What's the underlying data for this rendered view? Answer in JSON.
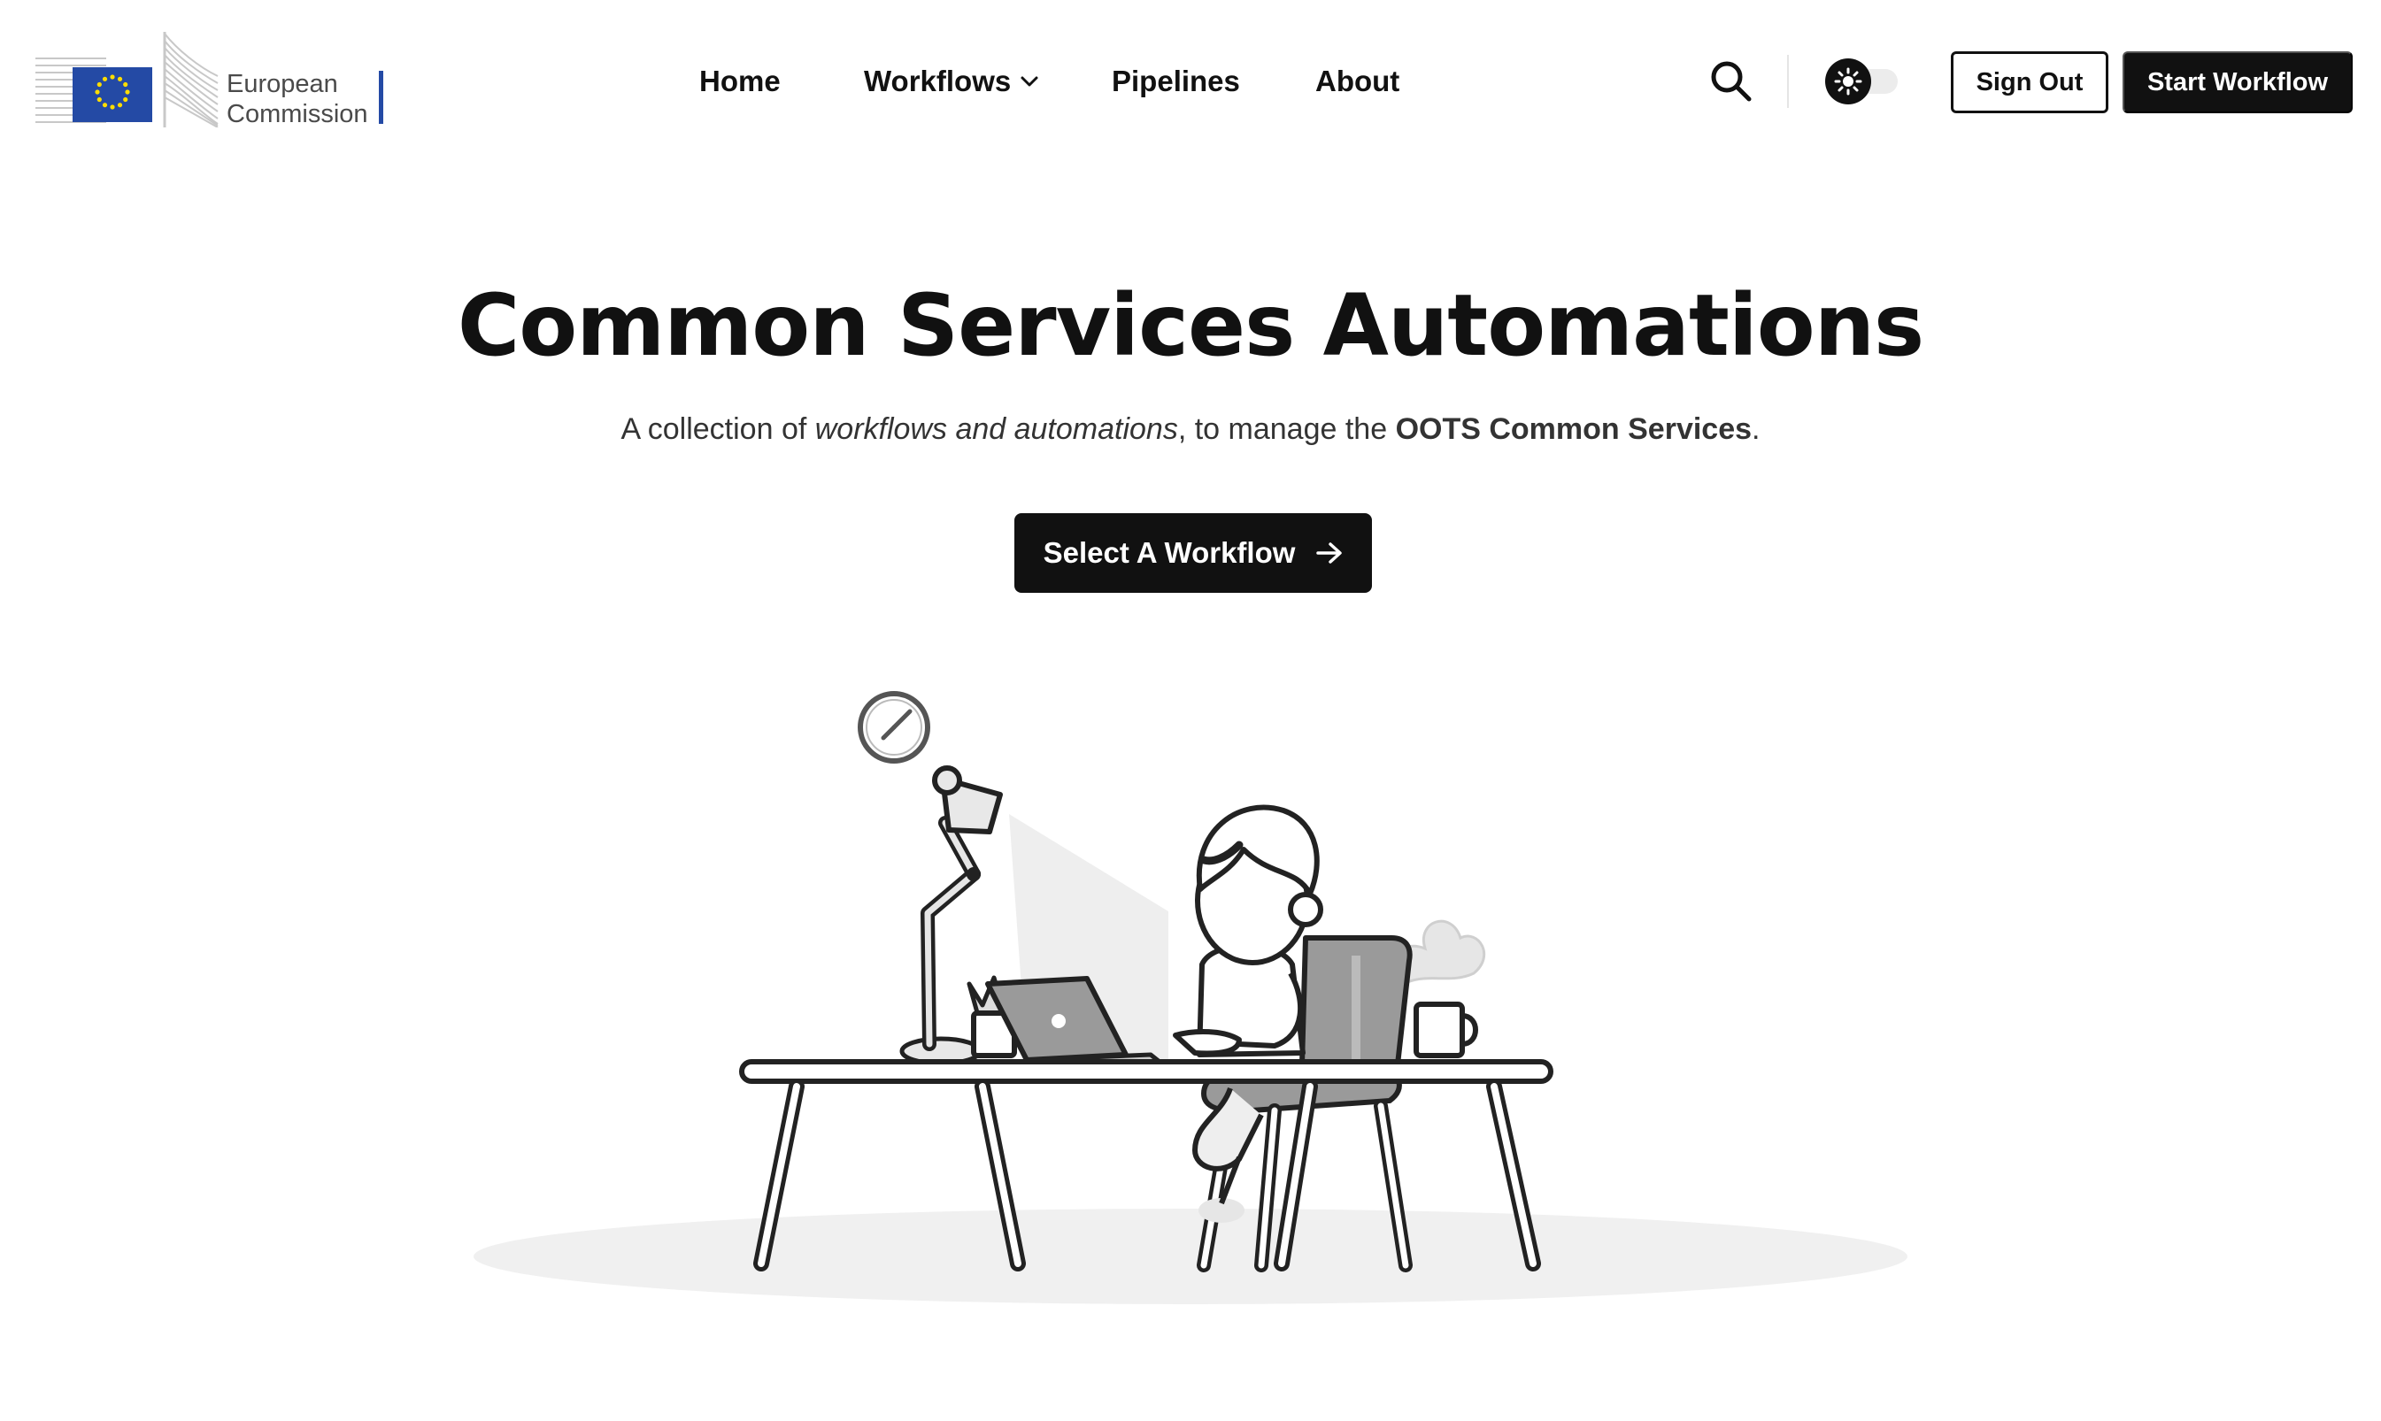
{
  "header": {
    "logo": {
      "line1": "European",
      "line2": "Commission",
      "alt": "European Commission"
    },
    "nav": {
      "home": "Home",
      "workflows": "Workflows",
      "pipelines": "Pipelines",
      "about": "About"
    },
    "icons": {
      "search": "search-icon",
      "theme": "sun-icon",
      "dropdown": "chevron-down-icon"
    },
    "sign_out_label": "Sign Out",
    "start_workflow_label": "Start Workflow"
  },
  "hero": {
    "title": "Common Services Automations",
    "subtitle": {
      "part1": "A collection of ",
      "emphasis": "workflows and automations",
      "part2": ", to manage the ",
      "strong": "OOTS Common Services",
      "part3": "."
    },
    "cta_label": "Select A Workflow",
    "cta_icon": "arrow-right-icon"
  },
  "theme": {
    "primary": "#111111",
    "background": "#ffffff",
    "eu_blue": "#244aa5",
    "eu_star": "#ffdd00"
  }
}
